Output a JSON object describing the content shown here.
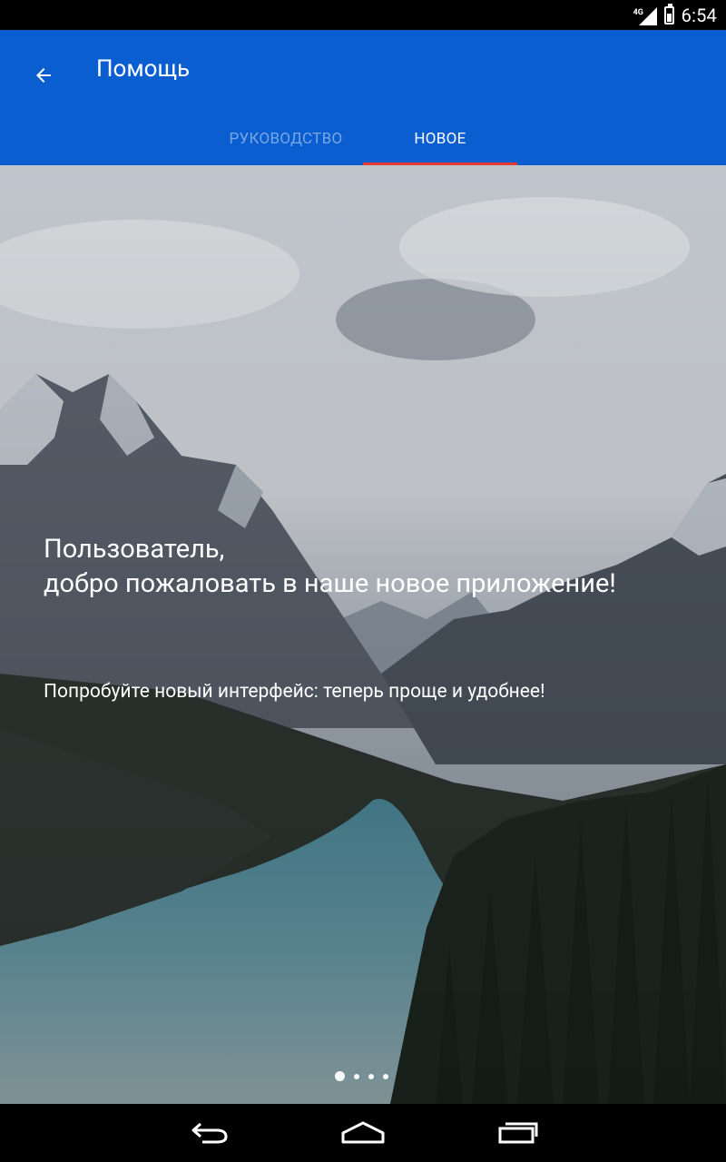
{
  "status_bar": {
    "time": "6:54",
    "network": "4G"
  },
  "app_bar": {
    "title": "Помощь",
    "back_icon": "arrow-back-icon"
  },
  "tabs": [
    {
      "label": "РУКОВОДСТВО",
      "active": false
    },
    {
      "label": "НОВОЕ",
      "active": true
    }
  ],
  "hero": {
    "headline_line1": "Пользователь,",
    "headline_line2": "добро пожаловать в наше новое приложение!",
    "subtext": "Попробуйте новый интерфейс: теперь проще и удобнее!",
    "page_indicator": {
      "count": 4,
      "active_index": 0
    }
  },
  "colors": {
    "app_bar": "#0A5ED0",
    "tab_indicator": "#E53935"
  },
  "nav_bar": {
    "icons": [
      "back-icon",
      "home-icon",
      "recents-icon"
    ]
  }
}
